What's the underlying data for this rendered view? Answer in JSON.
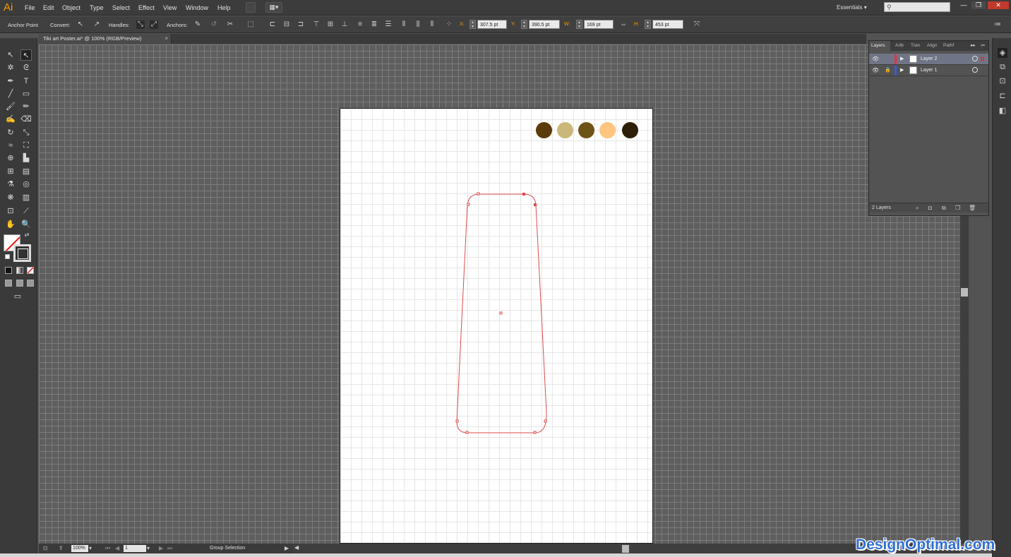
{
  "app": {
    "logo": "Ai"
  },
  "menu": [
    "File",
    "Edit",
    "Object",
    "Type",
    "Select",
    "Effect",
    "View",
    "Window",
    "Help"
  ],
  "workspace": "Essentials",
  "window_buttons": [
    "—",
    "❐",
    "✕"
  ],
  "control": {
    "anchor_point": "Anchor Point",
    "convert": "Convert:",
    "handles": "Handles:",
    "anchors": "Anchors:",
    "x_label": "X:",
    "x_value": "307.5 pt",
    "y_label": "Y:",
    "y_value": "390.5 pt",
    "w_label": "W:",
    "w_value": "169 pt",
    "h_label": "H:",
    "h_value": "453 pt"
  },
  "document": {
    "tab_title": "Tiki art Poster.ai* @ 100% (RGB/Preview)",
    "close": "×"
  },
  "swatches": [
    "#5a3b0a",
    "#c9b87a",
    "#6e5317",
    "#fdc57f",
    "#2e1f08"
  ],
  "status": {
    "zoom": "100%",
    "artboard": "1",
    "tool": "Group Selection"
  },
  "layers": {
    "tabs": [
      "Layers",
      "Artb",
      "Tran",
      "Align",
      "Pathf"
    ],
    "rows": [
      {
        "name": "Layer 2",
        "color": "#e8314a",
        "selected": true
      },
      {
        "name": "Layer 1",
        "color": "#3b5bdc",
        "selected": false
      }
    ],
    "count": "2 Layers"
  },
  "watermark": "DesignOptimal.com"
}
